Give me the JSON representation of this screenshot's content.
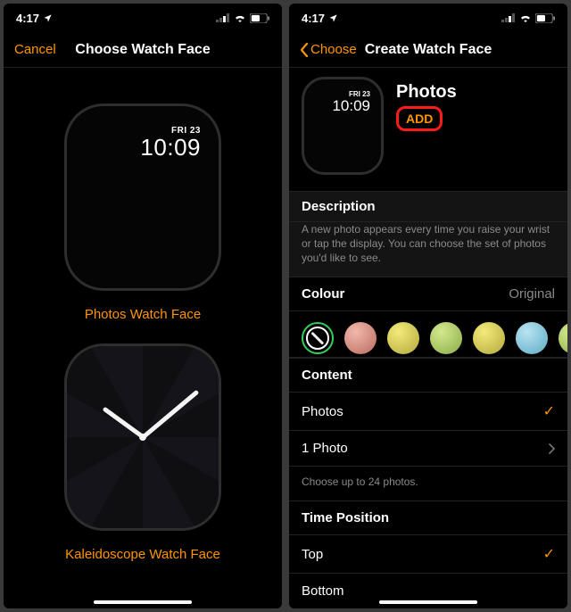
{
  "status": {
    "time": "4:17",
    "location_on": true,
    "wifi": true,
    "battery_low": false
  },
  "leftScreen": {
    "nav": {
      "cancel": "Cancel",
      "title": "Choose Watch Face"
    },
    "faces": [
      {
        "day": "FRI 23",
        "time": "10:09",
        "label": "Photos Watch Face"
      },
      {
        "label": "Kaleidoscope Watch Face"
      }
    ]
  },
  "rightScreen": {
    "nav": {
      "back": "Choose",
      "title": "Create Watch Face"
    },
    "hero": {
      "day": "FRI 23",
      "time": "10:09",
      "name": "Photos",
      "add": "ADD"
    },
    "description": {
      "header": "Description",
      "text": "A new photo appears every time you raise your wrist or tap the display. You can choose the set of photos you'd like to see."
    },
    "colour": {
      "header": "Colour",
      "selected": "Original",
      "swatches": [
        "original",
        "#d88f85",
        "#d6cf57",
        "#b0cf68",
        "#d6cf57",
        "#8fcfe0",
        "#b0cf68"
      ]
    },
    "content": {
      "header": "Content",
      "rows": [
        {
          "label": "Photos",
          "checked": true
        },
        {
          "label": "1 Photo",
          "disclosure": true
        }
      ],
      "note": "Choose up to 24 photos."
    },
    "timePosition": {
      "header": "Time Position",
      "rows": [
        {
          "label": "Top",
          "checked": true
        },
        {
          "label": "Bottom",
          "checked": false
        }
      ]
    }
  }
}
